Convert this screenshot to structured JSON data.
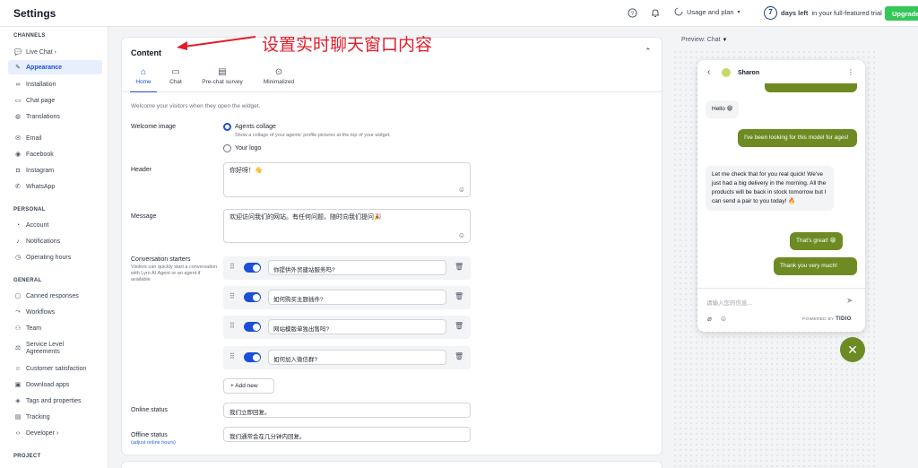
{
  "topbar": {
    "title": "Settings",
    "help_icon": "question-icon",
    "bell_icon": "bell-icon",
    "usage_label": "Usage and plan",
    "trial_days": "7",
    "trial_bold": "days left",
    "trial_rest": "in your full-featured trial",
    "upgrade_label": "Upgrade"
  },
  "sidebar": {
    "channels_title": "CHANNELS",
    "channels": [
      {
        "label": "Live Chat ›",
        "icon": "chat-icon"
      },
      {
        "label": "Appearance",
        "icon": "brush-icon",
        "active": true
      },
      {
        "label": "Installation",
        "icon": "link-icon"
      },
      {
        "label": "Chat page",
        "icon": "page-icon"
      },
      {
        "label": "Translations",
        "icon": "globe-icon"
      },
      {
        "label": "Email",
        "icon": "mail-icon"
      },
      {
        "label": "Facebook",
        "icon": "facebook-icon"
      },
      {
        "label": "Instagram",
        "icon": "instagram-icon"
      },
      {
        "label": "WhatsApp",
        "icon": "whatsapp-icon"
      }
    ],
    "personal_title": "PERSONAL",
    "personal": [
      {
        "label": "Account",
        "icon": "user-icon"
      },
      {
        "label": "Notifications",
        "icon": "bell-icon"
      },
      {
        "label": "Operating hours",
        "icon": "clock-icon"
      }
    ],
    "general_title": "GENERAL",
    "general": [
      {
        "label": "Canned responses",
        "icon": "bubble-icon"
      },
      {
        "label": "Workflows",
        "icon": "workflow-icon"
      },
      {
        "label": "Team",
        "icon": "team-icon"
      },
      {
        "label": "Service Level Agreements",
        "icon": "sla-icon"
      },
      {
        "label": "Customer satisfaction",
        "icon": "smile-icon"
      },
      {
        "label": "Download apps",
        "icon": "download-icon"
      },
      {
        "label": "Tags and properties",
        "icon": "tag-icon"
      },
      {
        "label": "Tracking",
        "icon": "tracking-icon"
      },
      {
        "label": "Developer ›",
        "icon": "code-icon"
      }
    ],
    "project_title": "PROJECT"
  },
  "content": {
    "title": "Content",
    "tabs": [
      {
        "label": "Home",
        "icon": "home-icon"
      },
      {
        "label": "Chat",
        "icon": "chat-icon"
      },
      {
        "label": "Pre-chat survey",
        "icon": "clipboard-icon"
      },
      {
        "label": "Minimalized",
        "icon": "chevron-circle-icon"
      }
    ],
    "intro": "Welcome your visitors when they open the widget.",
    "welcome_image_label": "Welcome image",
    "option_collage": "Agents collage",
    "option_collage_hint": "Show a collage of your agents' profile pictures at the top of your widget.",
    "option_logo": "Your logo",
    "header_label": "Header",
    "header_value": "你好呀！👋",
    "message_label": "Message",
    "message_value": "欢迎访问我们的网站。有任何问题，随时向我们提问🎉",
    "starters_label": "Conversation starters",
    "starters_hint": "Visitors can quickly start a conversation with Lyro AI Agent or an agent if available",
    "starters": [
      "你提供外贸建站服务吗?",
      "如何购买主题插件?",
      "网站模版单独出售吗?",
      "如何加入微信群?"
    ],
    "add_new": "Add new",
    "online_label": "Online status",
    "online_value": "我们立即回复。",
    "offline_label": "Offline status",
    "offline_hint": "(adjust online hours)",
    "offline_value": "我们通常会在几分钟内回复。"
  },
  "annotation": "设置实时聊天窗口内容",
  "preview": {
    "label": "Preview: Chat",
    "agent_name": "Sharon",
    "messages": [
      {
        "from": "agent",
        "text": "Hello 😁"
      },
      {
        "from": "visitor",
        "text": "I've been looking for this model for ages!"
      },
      {
        "from": "agent",
        "text": "Let me check that for you real quick! We've just had a big delivery in the morning. All the products will be back in stock tomorrow but I can send a pair to you today! 🔥"
      },
      {
        "from": "visitor",
        "text": "That's great! 😁"
      },
      {
        "from": "visitor",
        "text": "Thank you very much!"
      }
    ],
    "input_placeholder": "请输入您的信息...",
    "powered_by": "POWERED BY",
    "brand": "TIDIO"
  }
}
